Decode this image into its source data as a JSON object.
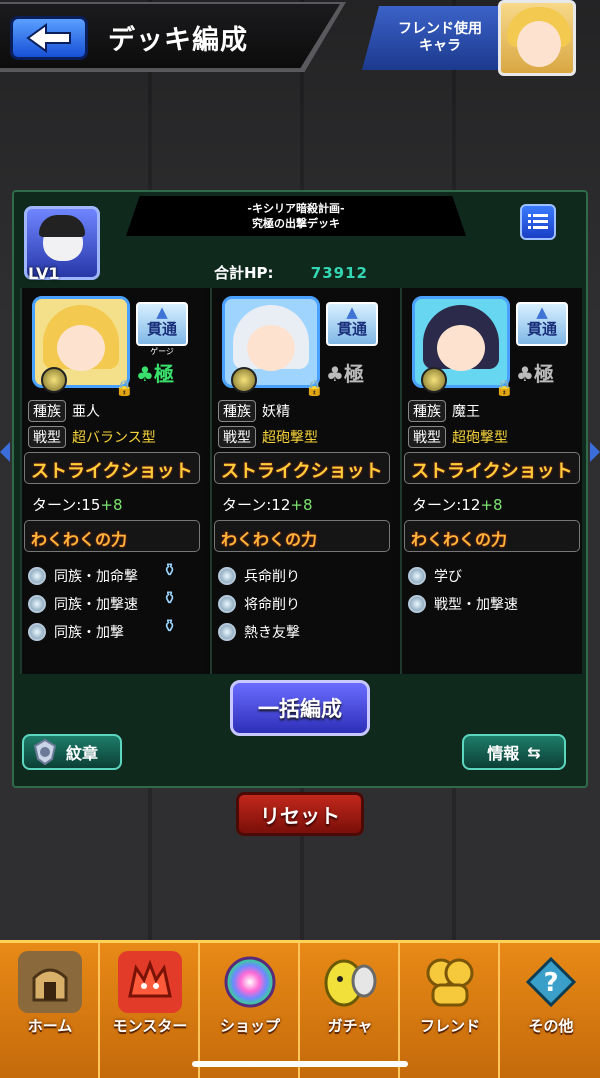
{
  "header": {
    "title": "デッキ編成",
    "friend_button": [
      "フレンド使用",
      "キャラ"
    ]
  },
  "deck": {
    "quest_title": "-キシリア暗殺計画-",
    "quest_subtitle": "究極の出撃デッキ",
    "leader_level": "LV1",
    "hp_label": "合計HP:",
    "hp_value": "73912"
  },
  "labels": {
    "race": "種族",
    "type": "戦型",
    "strike_shot": "ストライクショット",
    "wakuwaku": "わくわくの力"
  },
  "characters": [
    {
      "pierce": "貫通",
      "pierce_sub": "ゲージ",
      "rank": "極",
      "rank_color": "#39e06b",
      "race": "亜人",
      "type": "超バランス型",
      "turn": "ターン:15",
      "turn_plus": "+8",
      "abilities": [
        "同族・加命撃",
        "同族・加撃速",
        "同族・加撃"
      ],
      "hair_color": "#f3c94f",
      "bg_color": "#f4e08a"
    },
    {
      "pierce": "貫通",
      "pierce_sub": "",
      "rank": "極",
      "rank_color": "#bbbbbb",
      "race": "妖精",
      "type": "超砲撃型",
      "turn": "ターン:12",
      "turn_plus": "+8",
      "abilities": [
        "兵命削り",
        "将命削り",
        "熱き友撃"
      ],
      "hair_color": "#e9edf4",
      "bg_color": "#9fd4ff"
    },
    {
      "pierce": "貫通",
      "pierce_sub": "",
      "rank": "極",
      "rank_color": "#bbbbbb",
      "race": "魔王",
      "type": "超砲撃型",
      "turn": "ターン:12",
      "turn_plus": "+8",
      "abilities": [
        "学び",
        "戦型・加撃速"
      ],
      "hair_color": "#2b2a4a",
      "bg_color": "#67d6f0"
    }
  ],
  "buttons": {
    "bulk": "一括編成",
    "emblem": "紋章",
    "info": "情報",
    "reset": "リセット"
  },
  "nav": [
    {
      "label": "ホーム",
      "icon": "home-icon",
      "color": "#8a6a3c"
    },
    {
      "label": "モンスター",
      "icon": "monster-icon",
      "color": "#e23b2a"
    },
    {
      "label": "ショップ",
      "icon": "orb-icon",
      "color": "#7a4bd6"
    },
    {
      "label": "ガチャ",
      "icon": "gacha-egg-icon",
      "color": "#f1e03a"
    },
    {
      "label": "フレンド",
      "icon": "friend-icon",
      "color": "#f6c93c"
    },
    {
      "label": "その他",
      "icon": "question-icon",
      "color": "#3aa0c9"
    }
  ]
}
